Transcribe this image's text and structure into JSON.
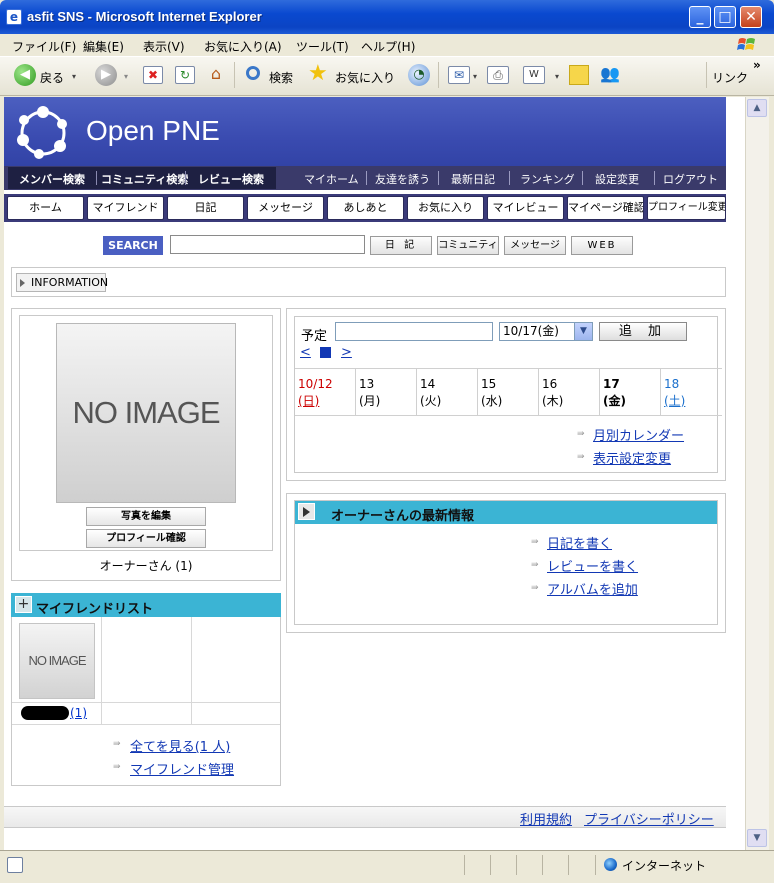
{
  "window": {
    "title": "asfit SNS - Microsoft Internet Explorer",
    "app_icon": "ie-page-icon",
    "min": "_",
    "max": "□",
    "close": "✕"
  },
  "menubar": {
    "items": [
      "ファイル(F)",
      "編集(E)",
      "表示(V)",
      "お気に入り(A)",
      "ツール(T)",
      "ヘルプ(H)"
    ]
  },
  "toolbar": {
    "back": "戻る",
    "search": "検索",
    "favorites": "お気に入り",
    "links": "リンク",
    "chevron": "»"
  },
  "statusbar": {
    "zone": "インターネット"
  },
  "site": {
    "logo": "Open PNE",
    "search_tabs": [
      "メンバー検索",
      "コミュニティ検索",
      "レビュー検索"
    ],
    "top_nav": [
      "マイホーム",
      "友達を誘う",
      "最新日記",
      "ランキング",
      "設定変更",
      "ログアウト"
    ],
    "main_nav": [
      "ホーム",
      "マイフレンド",
      "日記",
      "メッセージ",
      "あしあと",
      "お気に入り",
      "マイレビュー",
      "マイページ確認",
      "プロフィール変更"
    ],
    "search": {
      "label": "SEARCH",
      "value": "",
      "buttons": [
        "日 記",
        "コミュニティ",
        "メッセージ",
        "WEB"
      ]
    },
    "information": "INFORMATION",
    "profile": {
      "no_image": "NO IMAGE",
      "edit_photo": "写真を編集",
      "view_profile": "プロフィール確認",
      "owner": "オーナーさん (1)"
    },
    "friends": {
      "title": "マイフレンドリスト",
      "no_image": "NO IMAGE",
      "count": "(1)",
      "see_all": "全てを見る(1 人)",
      "manage": "マイフレンド管理"
    },
    "calendar": {
      "plan_label": "予定",
      "plan_value": "",
      "date_selected": "10/17(金)",
      "add_button": "追 加",
      "nav_prev": "<",
      "nav_next": ">",
      "days": [
        {
          "date": "10/12",
          "dow": "(日)",
          "color": "#cc0000"
        },
        {
          "date": "13",
          "dow": "(月)",
          "color": "#000000"
        },
        {
          "date": "14",
          "dow": "(火)",
          "color": "#000000"
        },
        {
          "date": "15",
          "dow": "(水)",
          "color": "#000000"
        },
        {
          "date": "16",
          "dow": "(木)",
          "color": "#000000"
        },
        {
          "date": "17",
          "dow": "(金)",
          "color": "#000000"
        },
        {
          "date": "18",
          "dow": "(土)",
          "color": "#1a6fcc"
        }
      ],
      "monthly_link": "月別カレンダー",
      "display_settings_link": "表示設定変更"
    },
    "news": {
      "title": "オーナーさんの最新情報",
      "links": [
        "日記を書く",
        "レビューを書く",
        "アルバムを追加"
      ]
    },
    "footer": {
      "terms": "利用規約",
      "privacy": "プライバシーポリシー"
    }
  }
}
